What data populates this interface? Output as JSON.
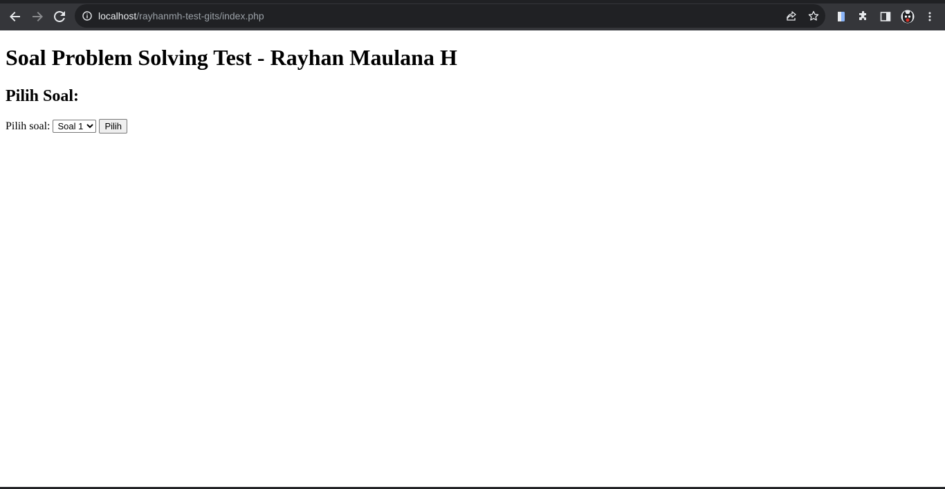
{
  "browser": {
    "url_host": "localhost",
    "url_path": "/rayhanmh-test-gits/index.php",
    "icons": [
      "back-icon",
      "forward-icon",
      "reload-icon",
      "info-icon",
      "share-icon",
      "star-icon",
      "doc-extension-icon",
      "puzzle-icon",
      "side-panel-icon",
      "profile-avatar",
      "menu-icon"
    ]
  },
  "page": {
    "title": "Soal Problem Solving Test - Rayhan Maulana H",
    "subtitle": "Pilih Soal:",
    "form": {
      "label": "Pilih soal:",
      "selected": "Soal 1",
      "button": "Pilih"
    }
  }
}
